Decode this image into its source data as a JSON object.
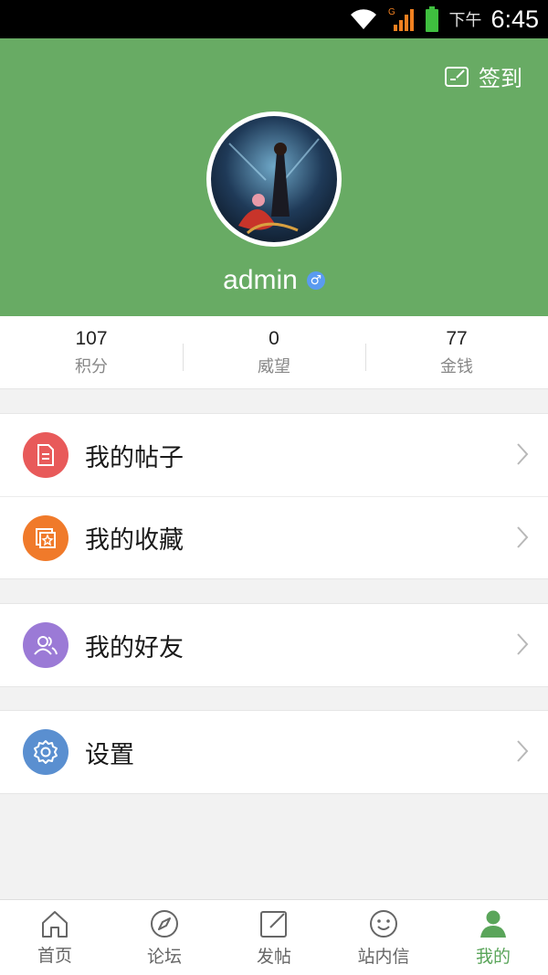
{
  "status_bar": {
    "ampm": "下午",
    "time": "6:45",
    "network_label": "G"
  },
  "header": {
    "checkin_label": "签到",
    "username": "admin",
    "gender_symbol": "♂"
  },
  "stats": [
    {
      "value": "107",
      "label": "积分"
    },
    {
      "value": "0",
      "label": "威望"
    },
    {
      "value": "77",
      "label": "金钱"
    }
  ],
  "menu": {
    "my_posts": "我的帖子",
    "my_favorites": "我的收藏",
    "my_friends": "我的好友",
    "settings": "设置"
  },
  "tabs": [
    {
      "label": "首页",
      "icon": "home-icon"
    },
    {
      "label": "论坛",
      "icon": "compass-icon"
    },
    {
      "label": "发帖",
      "icon": "edit-icon"
    },
    {
      "label": "站内信",
      "icon": "smiley-icon"
    },
    {
      "label": "我的",
      "icon": "user-icon",
      "active": true
    }
  ],
  "colors": {
    "header_green": "#68ab64",
    "active_tab": "#5aa55a",
    "posts_icon": "#e85a5a",
    "favorites_icon": "#f07a2a",
    "friends_icon": "#9b7ad6",
    "settings_icon": "#5a8fd0"
  }
}
